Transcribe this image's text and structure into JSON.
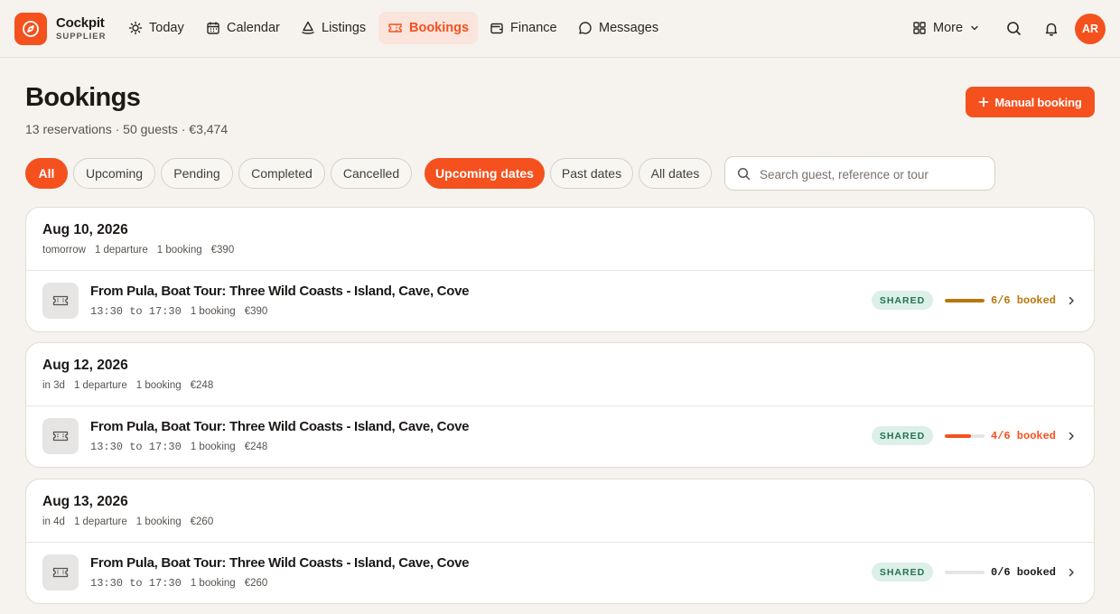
{
  "brand": {
    "name": "Cockpit",
    "subtitle": "SUPPLIER"
  },
  "nav": {
    "items": [
      {
        "label": "Today",
        "icon": "sun-icon"
      },
      {
        "label": "Calendar",
        "icon": "calendar-icon"
      },
      {
        "label": "Listings",
        "icon": "sailboat-icon"
      },
      {
        "label": "Bookings",
        "icon": "ticket-icon",
        "active": true
      },
      {
        "label": "Finance",
        "icon": "wallet-icon"
      },
      {
        "label": "Messages",
        "icon": "chat-bubble-icon"
      }
    ],
    "more_label": "More",
    "user_initials": "AR"
  },
  "page": {
    "title": "Bookings",
    "summary": "13 reservations · 50 guests · €3,474",
    "manual_booking_label": "Manual booking"
  },
  "filters": {
    "status": [
      "All",
      "Upcoming",
      "Pending",
      "Completed",
      "Cancelled"
    ],
    "status_selected": "All",
    "dates": [
      "Upcoming dates",
      "Past dates",
      "All dates"
    ],
    "dates_selected": "Upcoming dates",
    "search_placeholder": "Search guest, reference or tour",
    "search_value": ""
  },
  "groups": [
    {
      "date": "Aug 10, 2026",
      "relative": "tomorrow",
      "departures": "1 departure",
      "bookings": "1 booking",
      "total": "€390",
      "rows": [
        {
          "title": "From Pula, Boat Tour: Three Wild Coasts - Island, Cave, Cove",
          "time": "13:30 to 17:30",
          "bookings": "1 booking",
          "amount": "€390",
          "badge": "SHARED",
          "booked": 6,
          "capacity": 6,
          "booked_label": "6/6 booked",
          "status_color": "#b8770c"
        }
      ]
    },
    {
      "date": "Aug 12, 2026",
      "relative": "in 3d",
      "departures": "1 departure",
      "bookings": "1 booking",
      "total": "€248",
      "rows": [
        {
          "title": "From Pula, Boat Tour: Three Wild Coasts - Island, Cave, Cove",
          "time": "13:30 to 17:30",
          "bookings": "1 booking",
          "amount": "€248",
          "badge": "SHARED",
          "booked": 4,
          "capacity": 6,
          "booked_label": "4/6 booked",
          "status_color": "#f4511e"
        }
      ]
    },
    {
      "date": "Aug 13, 2026",
      "relative": "in 4d",
      "departures": "1 departure",
      "bookings": "1 booking",
      "total": "€260",
      "rows": [
        {
          "title": "From Pula, Boat Tour: Three Wild Coasts - Island, Cave, Cove",
          "time": "13:30 to 17:30",
          "bookings": "1 booking",
          "amount": "€260",
          "badge": "SHARED",
          "booked": 0,
          "capacity": 6,
          "booked_label": "0/6 booked",
          "status_color": "#1c1917"
        }
      ]
    }
  ],
  "colors": {
    "accent": "#f4511e",
    "shared_badge_bg": "#dcefe8",
    "shared_badge_text": "#23734f",
    "page_bg": "#f6f3ee"
  }
}
